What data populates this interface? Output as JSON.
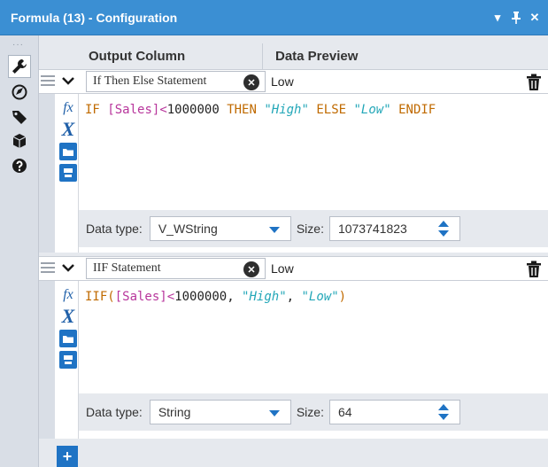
{
  "window": {
    "title": "Formula (13) - Configuration"
  },
  "columns": {
    "output": "Output Column",
    "preview": "Data Preview"
  },
  "formulas": [
    {
      "name": "If Then Else Statement",
      "preview": "Low",
      "expression": {
        "t1": "IF ",
        "t2": "[Sales]",
        "t3": "<",
        "t4": "1000000",
        "t5": " THEN ",
        "t6": "\"High\"",
        "t7": " ELSE ",
        "t8": "\"Low\"",
        "t9": " ENDIF"
      },
      "data_type_label": "Data type:",
      "data_type": "V_WString",
      "size_label": "Size:",
      "size": "1073741823"
    },
    {
      "name": "IIF Statement",
      "preview": "Low",
      "expression": {
        "t1": "IIF(",
        "t2": "[Sales]",
        "t3": "<",
        "t4": "1000000",
        "t5": ", ",
        "t6": "\"High\"",
        "t7": ", ",
        "t8": "\"Low\"",
        "t9": ")"
      },
      "data_type_label": "Data type:",
      "data_type": "String",
      "size_label": "Size:",
      "size": "64"
    }
  ],
  "colors": {
    "accent": "#3b8fd3",
    "tool_blue": "#1f73c4"
  }
}
